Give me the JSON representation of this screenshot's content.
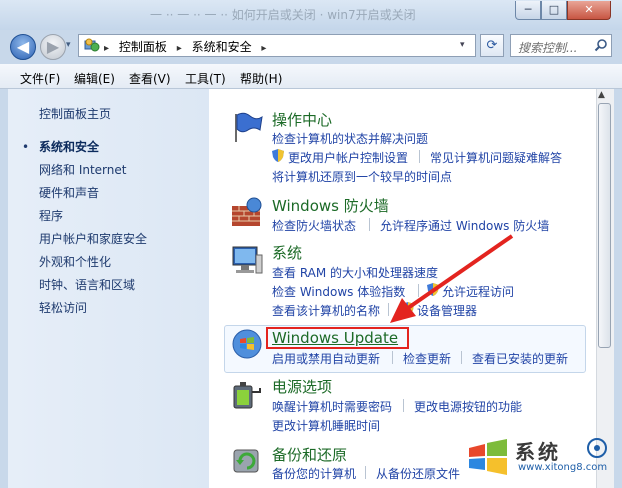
{
  "window": {
    "title_faded": "一 ·· 一 ·· 一 ·· 如何开启或关闭 · win7开启或关闭",
    "min_glyph": "─",
    "max_glyph": "□",
    "close_glyph": "✕"
  },
  "nav": {
    "back_glyph": "◀",
    "forward_glyph": "▶",
    "recent_glyph": "▾",
    "dropdown_glyph": "▾",
    "refresh_glyph": "⟳",
    "breadcrumb": [
      "控制面板",
      "系统和安全"
    ],
    "breadcrumb_sep": "▸",
    "search_placeholder": "搜索控制..."
  },
  "menu": [
    "文件(F)",
    "编辑(E)",
    "查看(V)",
    "工具(T)",
    "帮助(H)"
  ],
  "left": {
    "home": "控制面板主页",
    "bullet": "•",
    "items": [
      "系统和安全",
      "网络和 Internet",
      "硬件和声音",
      "程序",
      "用户帐户和家庭安全",
      "外观和个性化",
      "时钟、语言和区域",
      "轻松访问"
    ]
  },
  "categories": {
    "action_center": {
      "title": "操作中心",
      "task1": "检查计算机的状态并解决问题",
      "task2": "更改用户帐户控制设置",
      "task3": "常见计算机问题疑难解答",
      "task4": "将计算机还原到一个较早的时间点"
    },
    "firewall": {
      "title": "Windows 防火墙",
      "task1": "检查防火墙状态",
      "task2": "允许程序通过 Windows 防火墙"
    },
    "system": {
      "title": "系统",
      "task1": "查看 RAM 的大小和处理器速度",
      "task2": "检查 Windows 体验指数",
      "task3": "允许远程访问",
      "task4": "查看该计算机的名称",
      "task5": "设备管理器"
    },
    "windows_update": {
      "title": "Windows Update",
      "task1": "启用或禁用自动更新",
      "task2": "检查更新",
      "task3": "查看已安装的更新"
    },
    "power": {
      "title": "电源选项",
      "task1": "唤醒计算机时需要密码",
      "task2": "更改电源按钮的功能",
      "task3": "更改计算机睡眠时间"
    },
    "backup": {
      "title": "备份和还原",
      "task1": "备份您的计算机",
      "task2": "从备份还原文件"
    }
  },
  "watermark": {
    "text": "系统",
    "url": "www.xitong8.com"
  },
  "colors": {
    "link": "#2144a6",
    "category_title": "#1c6a27",
    "annotation_red": "#e3241f"
  }
}
